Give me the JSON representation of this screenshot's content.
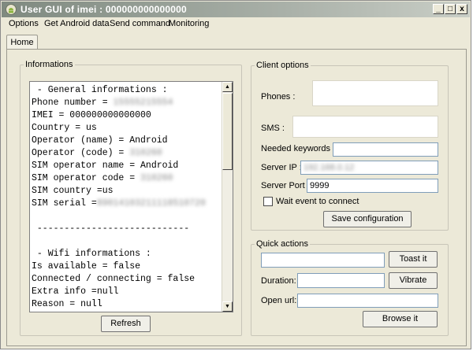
{
  "window": {
    "title": "User GUI of imei : 000000000000000",
    "minimize": "_",
    "maximize": "□",
    "close": "x"
  },
  "menu": [
    "Options",
    "Get Android data",
    "Send command",
    "Monitoring"
  ],
  "tabs": {
    "home": "Home"
  },
  "informations": {
    "label": "Informations",
    "lines": [
      " - General informations :",
      "Phone number = ",
      "IMEI = 000000000000000",
      "Country = us",
      "Operator (name) = Android",
      "Operator (code) = ",
      "SIM operator name = Android",
      "SIM operator code = ",
      "SIM country =us",
      "SIM serial =",
      "",
      " ----------------------------",
      "",
      " - Wifi informations :",
      "Is available = false",
      "Connected / connecting = false",
      "Extra info =null",
      "Reason = null"
    ],
    "redacted": {
      "phone": "15555215554",
      "op_code": "310260",
      "sim_op_code": "310260",
      "sim_serial": "89014103211118510720"
    },
    "refresh_label": "Refresh"
  },
  "client_options": {
    "label": "Client options",
    "phones_label": "Phones :",
    "sms_label": "SMS :",
    "keywords_label": "Needed keywords :",
    "keywords_value": "",
    "server_ip_label": "Server IP :",
    "server_ip_value": "192.168.0.12",
    "server_port_label": "Server Port :",
    "server_port_value": "9999",
    "wait_event_label": "Wait event to connect",
    "wait_event_checked": false,
    "save_label": "Save configuration"
  },
  "quick_actions": {
    "label": "Quick actions",
    "toast_value": "",
    "toast_label": "Toast it",
    "duration_label": "Duration:",
    "duration_value": "",
    "vibrate_label": "Vibrate",
    "open_url_label": "Open url:",
    "open_url_value": "",
    "browse_label": "Browse it"
  }
}
